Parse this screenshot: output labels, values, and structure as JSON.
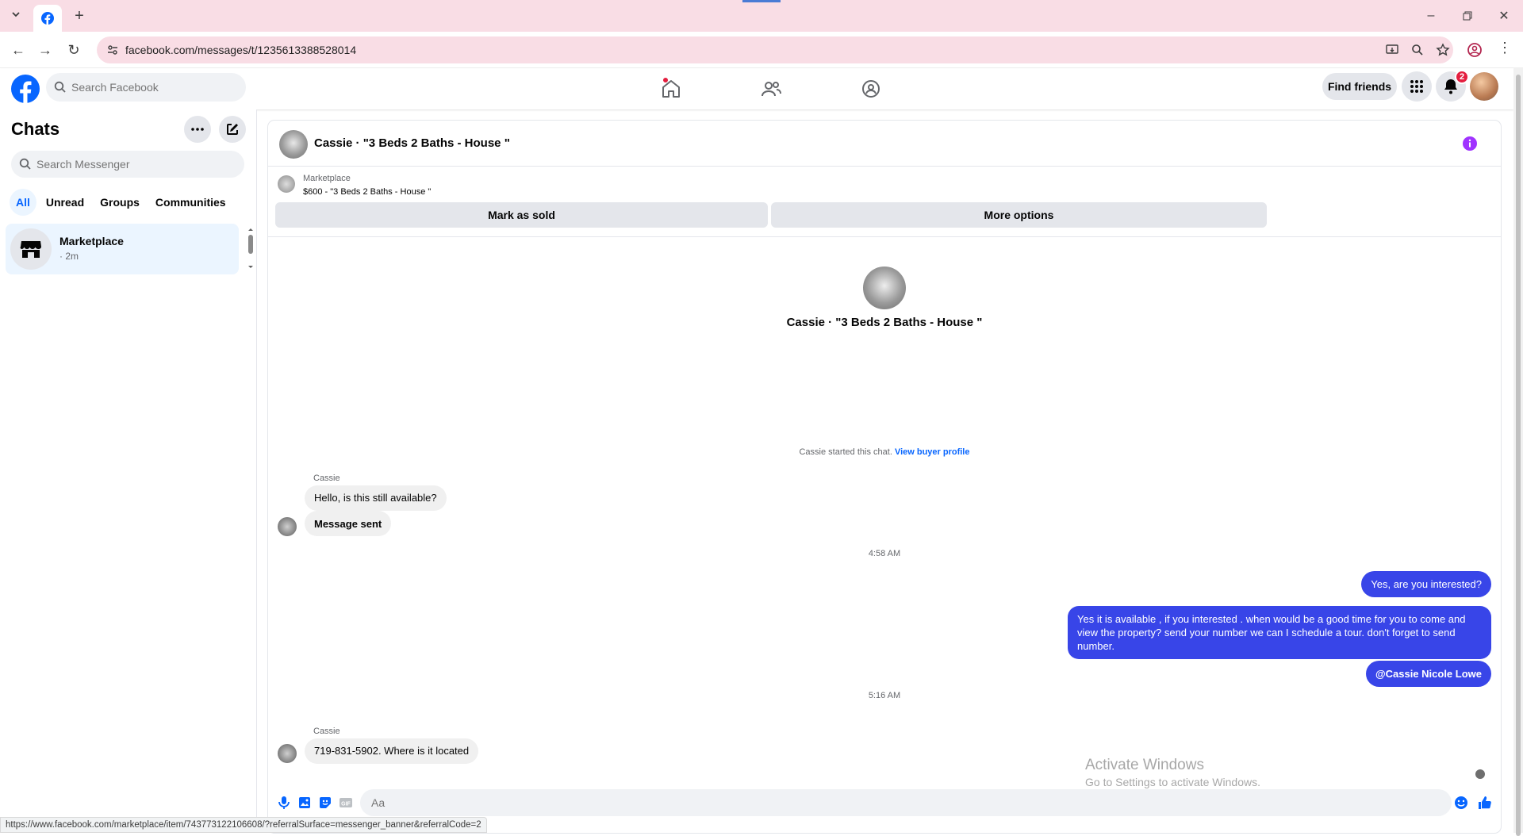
{
  "browser": {
    "url": "facebook.com/messages/t/1235613388528014",
    "status_url": "https://www.facebook.com/marketplace/item/743773122106608/?referralSurface=messenger_banner&referralCode=2"
  },
  "fb_header": {
    "search_placeholder": "Search Facebook",
    "find_friends": "Find friends",
    "notification_count": "2"
  },
  "sidebar": {
    "title": "Chats",
    "search_placeholder": "Search Messenger",
    "filters": [
      "All",
      "Unread",
      "Groups",
      "Communities"
    ],
    "active_filter": "All",
    "chats": [
      {
        "name": "Marketplace",
        "time": "· 2m"
      }
    ]
  },
  "conversation": {
    "title": "Cassie · \"3 Beds 2 Baths - House \"",
    "listing": {
      "category": "Marketplace",
      "price_title": "$600 - \"3 Beds 2 Baths - House \"",
      "mark_sold": "Mark as sold",
      "more_options": "More options"
    },
    "center_name": "Cassie · \"3 Beds 2 Baths - House \"",
    "started_text": "Cassie started this chat.",
    "buyer_profile_link": "View buyer profile",
    "messages": {
      "sender1": "Cassie",
      "in1": "Hello, is this still available?",
      "in2": "Message sent",
      "ts1": "4:58 AM",
      "out1": "Yes, are you interested?",
      "out2": "Yes it is available , if you interested . when would be  a good time for you to come and view the  property? send your number we can I schedule  a tour. don't forget to send  number.",
      "out3": "@Cassie Nicole Lowe",
      "ts2": "5:16 AM",
      "sender2": "Cassie",
      "in3": "719-831-5902.  Where is it located"
    },
    "composer_placeholder": "Aa"
  },
  "watermark": {
    "line1": "Activate Windows",
    "line2": "Go to Settings to activate Windows."
  },
  "colors": {
    "fb_blue": "#0866ff",
    "outgoing_bubble": "#3845e8",
    "chrome_tint": "#f9dde5",
    "notification_red": "#e41e3f"
  }
}
